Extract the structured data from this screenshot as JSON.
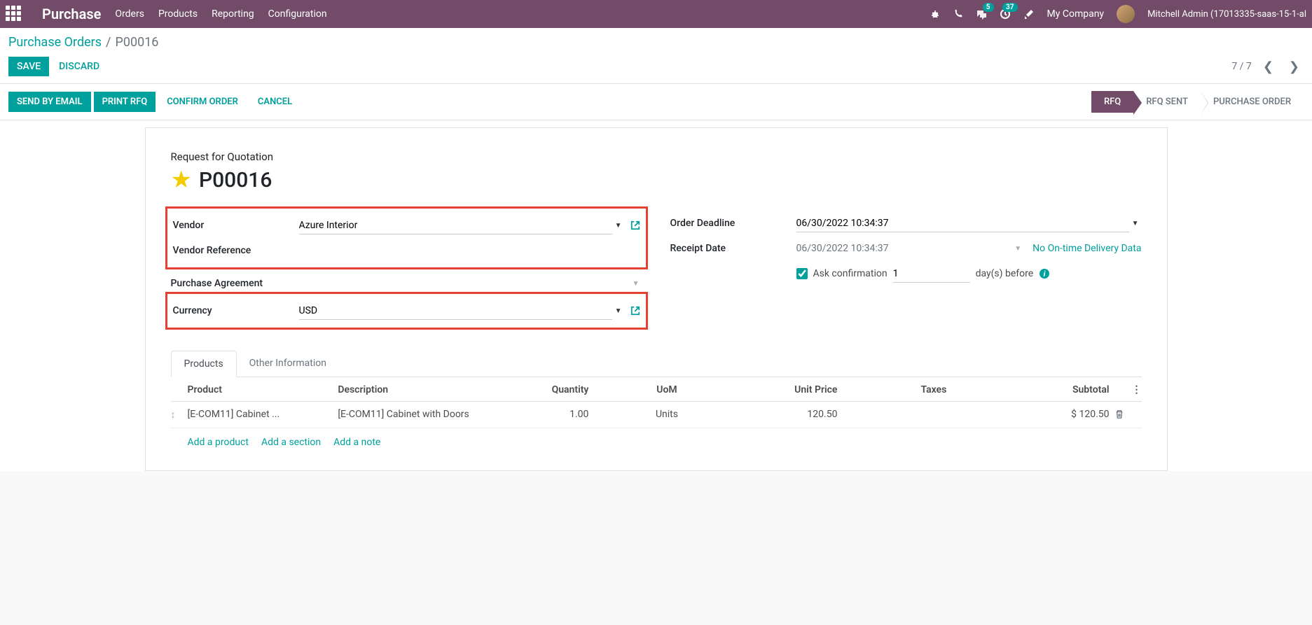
{
  "topbar": {
    "app_title": "Purchase",
    "nav": [
      "Orders",
      "Products",
      "Reporting",
      "Configuration"
    ],
    "chat_badge": "5",
    "activity_badge": "37",
    "company": "My Company",
    "user": "Mitchell Admin (17013335-saas-15-1-al"
  },
  "breadcrumb": {
    "parent": "Purchase Orders",
    "current": "P00016"
  },
  "buttons": {
    "save": "SAVE",
    "discard": "DISCARD",
    "send_email": "SEND BY EMAIL",
    "print_rfq": "PRINT RFQ",
    "confirm": "CONFIRM ORDER",
    "cancel": "CANCEL"
  },
  "pager": {
    "text": "7 / 7"
  },
  "status": {
    "steps": [
      "RFQ",
      "RFQ SENT",
      "PURCHASE ORDER"
    ],
    "active": 0
  },
  "form": {
    "title_label": "Request for Quotation",
    "title": "P00016",
    "vendor_label": "Vendor",
    "vendor": "Azure Interior",
    "vendor_ref_label": "Vendor Reference",
    "agreement_label": "Purchase Agreement",
    "currency_label": "Currency",
    "currency": "USD",
    "deadline_label": "Order Deadline",
    "deadline": "06/30/2022 10:34:37",
    "receipt_label": "Receipt Date",
    "receipt": "06/30/2022 10:34:37",
    "no_data": "No On-time Delivery Data",
    "ask_conf_label": "Ask confirmation",
    "ask_conf_days": "1",
    "ask_conf_suffix": "day(s) before"
  },
  "tabs": {
    "products": "Products",
    "other": "Other Information"
  },
  "grid": {
    "headers": {
      "product": "Product",
      "desc": "Description",
      "qty": "Quantity",
      "uom": "UoM",
      "price": "Unit Price",
      "taxes": "Taxes",
      "subtotal": "Subtotal"
    },
    "rows": [
      {
        "product": "[E-COM11] Cabinet ...",
        "desc": "[E-COM11] Cabinet with Doors",
        "qty": "1.00",
        "uom": "Units",
        "price": "120.50",
        "taxes": "",
        "subtotal": "$ 120.50"
      }
    ],
    "add_product": "Add a product",
    "add_section": "Add a section",
    "add_note": "Add a note"
  }
}
